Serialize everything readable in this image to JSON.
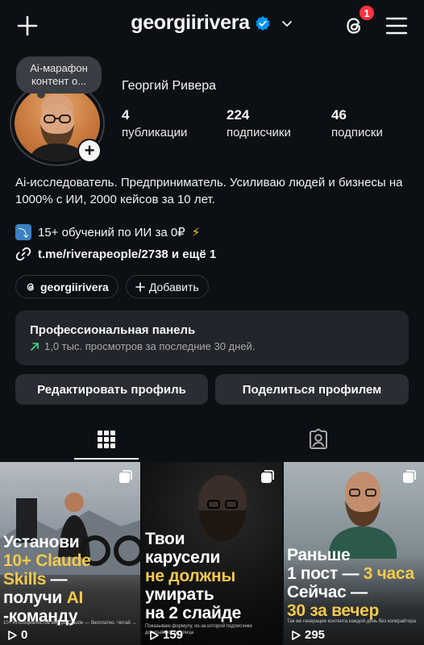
{
  "header": {
    "username": "georgiirivera",
    "notifications_count": "1",
    "icons": {
      "add": "plus-icon",
      "verified": "verified-badge-icon",
      "switch": "chevron-down-icon",
      "threads": "threads-icon",
      "menu": "hamburger-menu-icon"
    }
  },
  "profile": {
    "note": "Ai-марафон контент о...",
    "full_name": "Георгий Ривера",
    "stats": [
      {
        "value": "4",
        "label": "публикации"
      },
      {
        "value": "224",
        "label": "подписчики"
      },
      {
        "value": "46",
        "label": "подписки"
      }
    ],
    "bio": "Ai-исследователь. Предприниматель. Усиливаю людей и бизнесы на 1000% с ИИ, 2000 кейсов за 10 лет.",
    "bio_line2": "15+ обучений по ИИ за 0₽",
    "bio_line2_emoji": "⤵",
    "bio_line2_suffix": "⚡",
    "link": "t.me/riverapeople/2738 и ещё 1"
  },
  "chips": {
    "threads_label": "georgiirivera",
    "add_label": "Добавить"
  },
  "pro_panel": {
    "title": "Профессиональная панель",
    "subtitle": "1,0 тыс. просмотров за последние 30 дней."
  },
  "buttons": {
    "edit": "Редактировать профиль",
    "share": "Поделиться профилем"
  },
  "tabs": [
    {
      "name": "grid",
      "icon": "grid-icon"
    },
    {
      "name": "tagged",
      "icon": "tagged-person-icon"
    }
  ],
  "posts": [
    {
      "lines": [
        "Установи",
        "10+ Claude",
        "Skills —",
        "получи AI",
        "-команду"
      ],
      "caption": "10+ AI-специалистов внутри Claude — бесплатно. Читай →",
      "views": "0"
    },
    {
      "lines": [
        "Твои",
        "карусели",
        "не должны",
        "умирать",
        "на 2 слайде"
      ],
      "caption": "Показываю формулу, из-за которой подписчики дочитывают до конца",
      "views": "159"
    },
    {
      "lines": [
        "Раньше",
        "1 пост — 3 часа",
        "Сейчас —",
        "30 за вечер"
      ],
      "caption": "Так же генерация контента каждой день без копирайтера",
      "views": "295"
    }
  ],
  "colors": {
    "background": "#0c1014",
    "panel": "#22252b",
    "button": "#2a2d33",
    "badge": "#ff3040",
    "verified": "#0095f6",
    "highlight": "#f2c94c"
  }
}
